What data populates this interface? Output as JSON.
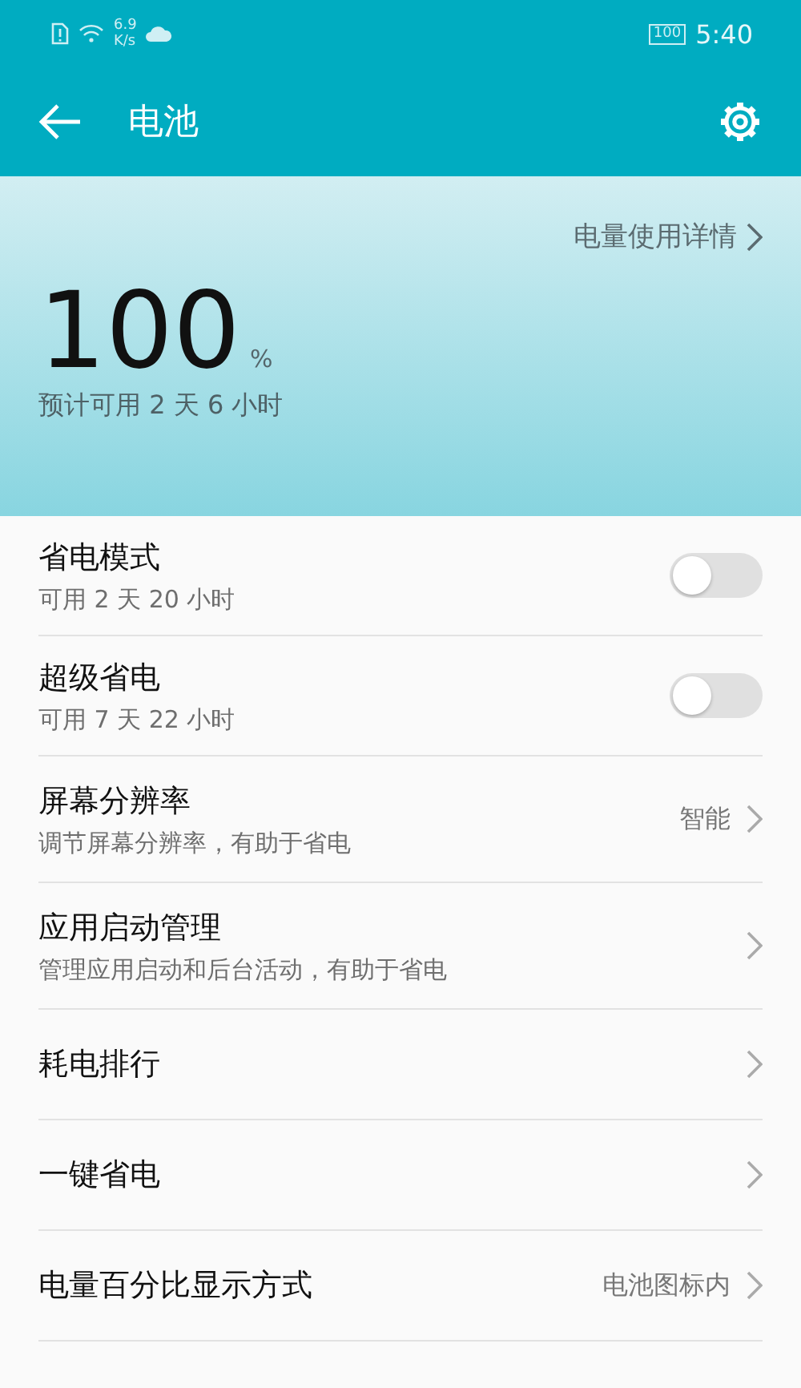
{
  "status_bar": {
    "speed_value": "6.9",
    "speed_unit": "K/s",
    "battery": "100",
    "time": "5:40"
  },
  "app_bar": {
    "title": "电池"
  },
  "summary": {
    "details_link": "电量使用详情",
    "percent": "100",
    "percent_unit": "%",
    "estimate": "预计可用 2 天 6 小时"
  },
  "settings": [
    {
      "kind": "switch",
      "title": "省电模式",
      "subtitle": "可用 2 天 20 小时",
      "on": false
    },
    {
      "kind": "switch",
      "title": "超级省电",
      "subtitle": "可用 7 天 22 小时",
      "on": false
    },
    {
      "kind": "nav",
      "title": "屏幕分辨率",
      "subtitle": "调节屏幕分辨率，有助于省电",
      "value": "智能"
    },
    {
      "kind": "nav",
      "title": "应用启动管理",
      "subtitle": "管理应用启动和后台活动，有助于省电"
    },
    {
      "kind": "nav",
      "title": "耗电排行"
    },
    {
      "kind": "nav",
      "title": "一键省电"
    },
    {
      "kind": "nav",
      "title": "电量百分比显示方式",
      "value": "电池图标内"
    }
  ]
}
